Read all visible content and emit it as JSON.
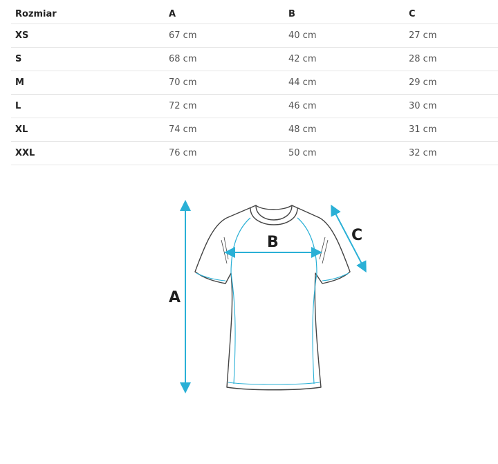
{
  "table": {
    "headers": [
      "Rozmiar",
      "A",
      "B",
      "C"
    ],
    "rows": [
      {
        "size": "XS",
        "a": "67 cm",
        "b": "40 cm",
        "c": "27 cm"
      },
      {
        "size": "S",
        "a": "68 cm",
        "b": "42 cm",
        "c": "28 cm"
      },
      {
        "size": "M",
        "a": "70 cm",
        "b": "44 cm",
        "c": "29 cm"
      },
      {
        "size": "L",
        "a": "72 cm",
        "b": "46 cm",
        "c": "30 cm"
      },
      {
        "size": "XL",
        "a": "74 cm",
        "b": "48 cm",
        "c": "31 cm"
      },
      {
        "size": "XXL",
        "a": "76 cm",
        "b": "50 cm",
        "c": "32 cm"
      }
    ]
  },
  "diagram": {
    "label_a": "A",
    "label_b": "B",
    "label_c": "C",
    "accent_color": "#2ab0d6",
    "outline_color": "#444444"
  }
}
